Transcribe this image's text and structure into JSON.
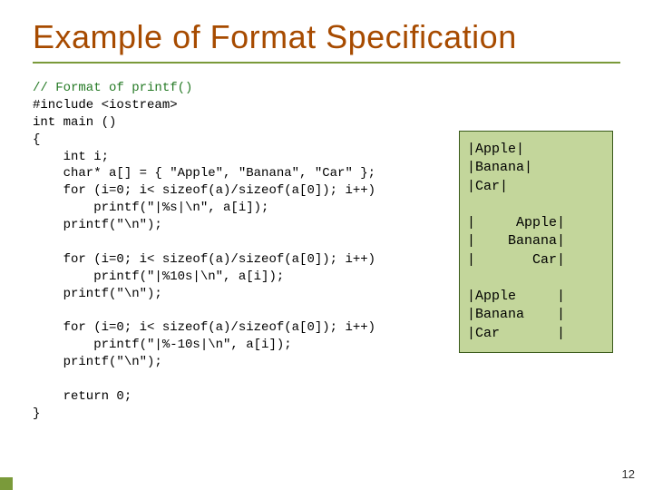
{
  "title": "Example of Format Specification",
  "code": {
    "l1": "// Format of printf()",
    "l2": "#include <iostream>",
    "l3": "int main ()",
    "l4": "{",
    "l5": "    int i;",
    "l6": "    char* a[] = { \"Apple\", \"Banana\", \"Car\" };",
    "l7": "    for (i=0; i< sizeof(a)/sizeof(a[0]); i++)",
    "l8": "        printf(\"|%s|\\n\", a[i]);",
    "l9": "    printf(\"\\n\");",
    "l10": "",
    "l11": "    for (i=0; i< sizeof(a)/sizeof(a[0]); i++)",
    "l12": "        printf(\"|%10s|\\n\", a[i]);",
    "l13": "    printf(\"\\n\");",
    "l14": "",
    "l15": "    for (i=0; i< sizeof(a)/sizeof(a[0]); i++)",
    "l16": "        printf(\"|%-10s|\\n\", a[i]);",
    "l17": "    printf(\"\\n\");",
    "l18": "",
    "l19": "    return 0;",
    "l20": "}"
  },
  "output": "|Apple|\n|Banana|\n|Car|\n\n|     Apple|\n|    Banana|\n|       Car|\n\n|Apple     |\n|Banana    |\n|Car       |",
  "page_number": "12"
}
